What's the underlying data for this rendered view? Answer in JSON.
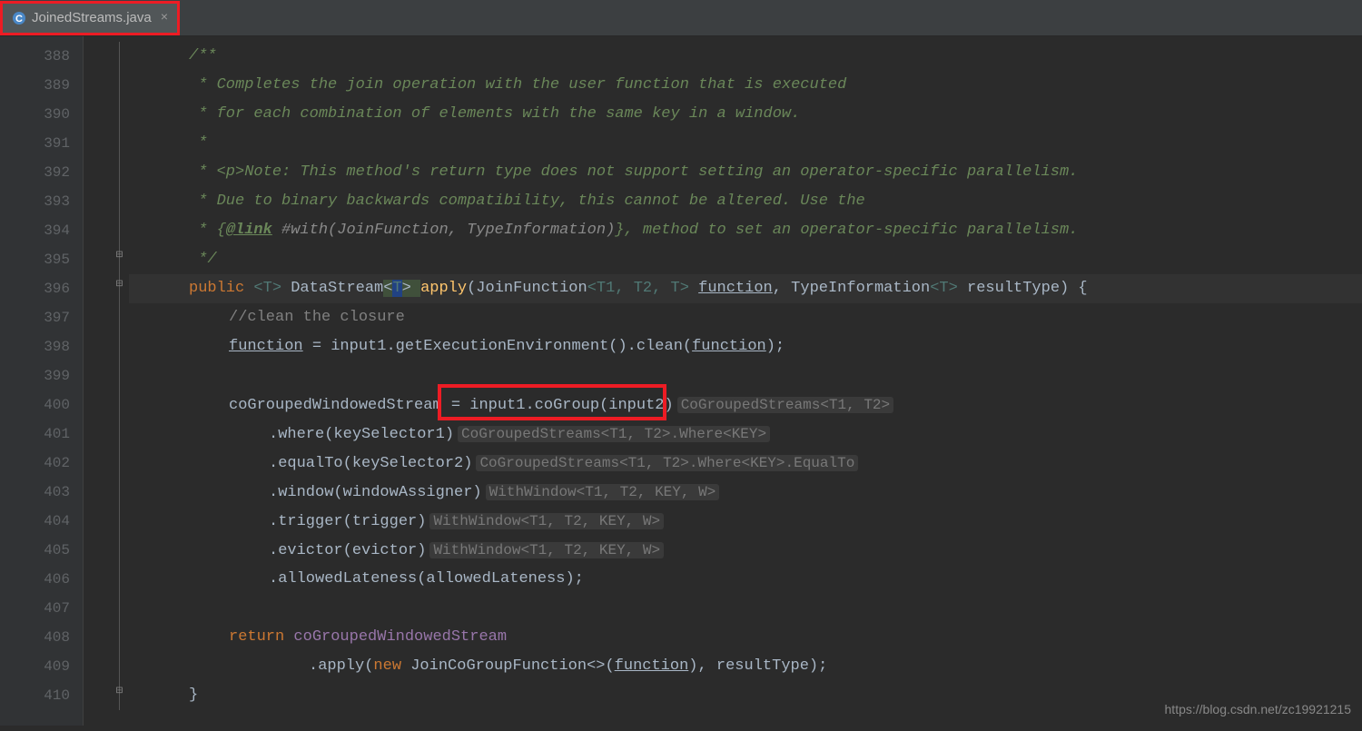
{
  "tab": {
    "filename": "JoinedStreams.java",
    "close_glyph": "×"
  },
  "watermark": "https://blog.csdn.net/zc19921215",
  "line_numbers": [
    "388",
    "389",
    "390",
    "391",
    "392",
    "393",
    "394",
    "395",
    "396",
    "397",
    "398",
    "399",
    "400",
    "401",
    "402",
    "403",
    "404",
    "405",
    "406",
    "407",
    "408",
    "409",
    "410"
  ],
  "code": {
    "l388": "/**",
    "l389": " * Completes the join operation with the user function that is executed",
    "l390": " * for each combination of elements with the same key in a window.",
    "l391": " *",
    "l392": " * <p>Note: This method's return type does not support setting an operator-specific parallelism.",
    "l393": " * Due to binary backwards compatibility, this cannot be altered. Use the",
    "l394_pre": " * {",
    "l394_tag": "@link",
    "l394_ref": " #with(JoinFunction, TypeInformation)",
    "l394_post": "}, method to set an operator-specific parallelism.",
    "l395": " */",
    "l396": {
      "kw1": "public ",
      "g1": "<T> ",
      "type1": "DataStream",
      "g2a": "<",
      "g2b": "T",
      "g2c": "> ",
      "method": "apply",
      "p1": "(JoinFunction",
      "g3": "<T1, T2, T> ",
      "param1": "function",
      "p2": ", TypeInformation",
      "g4": "<T>",
      "p3": " resultType) {"
    },
    "l397": "//clean the closure",
    "l398": {
      "a": "function",
      "b": " = input1.getExecutionEnvironment().clean(",
      "c": "function",
      "d": ");"
    },
    "l400": {
      "a": "coGroupedWindowedStream = ",
      "b": "input1.coGroup(input2)",
      "hint": "CoGroupedStreams<T1, T2>"
    },
    "l401": {
      "a": ".where(keySelector1)",
      "hint": "CoGroupedStreams<T1, T2>.Where<KEY>"
    },
    "l402": {
      "a": ".equalTo(keySelector2)",
      "hint": "CoGroupedStreams<T1, T2>.Where<KEY>.EqualTo"
    },
    "l403": {
      "a": ".window(windowAssigner)",
      "hint": "WithWindow<T1, T2, KEY, W>"
    },
    "l404": {
      "a": ".trigger(trigger)",
      "hint": "WithWindow<T1, T2, KEY, W>"
    },
    "l405": {
      "a": ".evictor(evictor)",
      "hint": "WithWindow<T1, T2, KEY, W>"
    },
    "l406": ".allowedLateness(allowedLateness);",
    "l408": {
      "kw": "return ",
      "a": "coGroupedWindowedStream"
    },
    "l409": {
      "a": ".apply(",
      "kw": "new ",
      "b": "JoinCoGroupFunction<>(",
      "c": "function",
      "d": "), resultType);"
    },
    "l410": "}"
  }
}
